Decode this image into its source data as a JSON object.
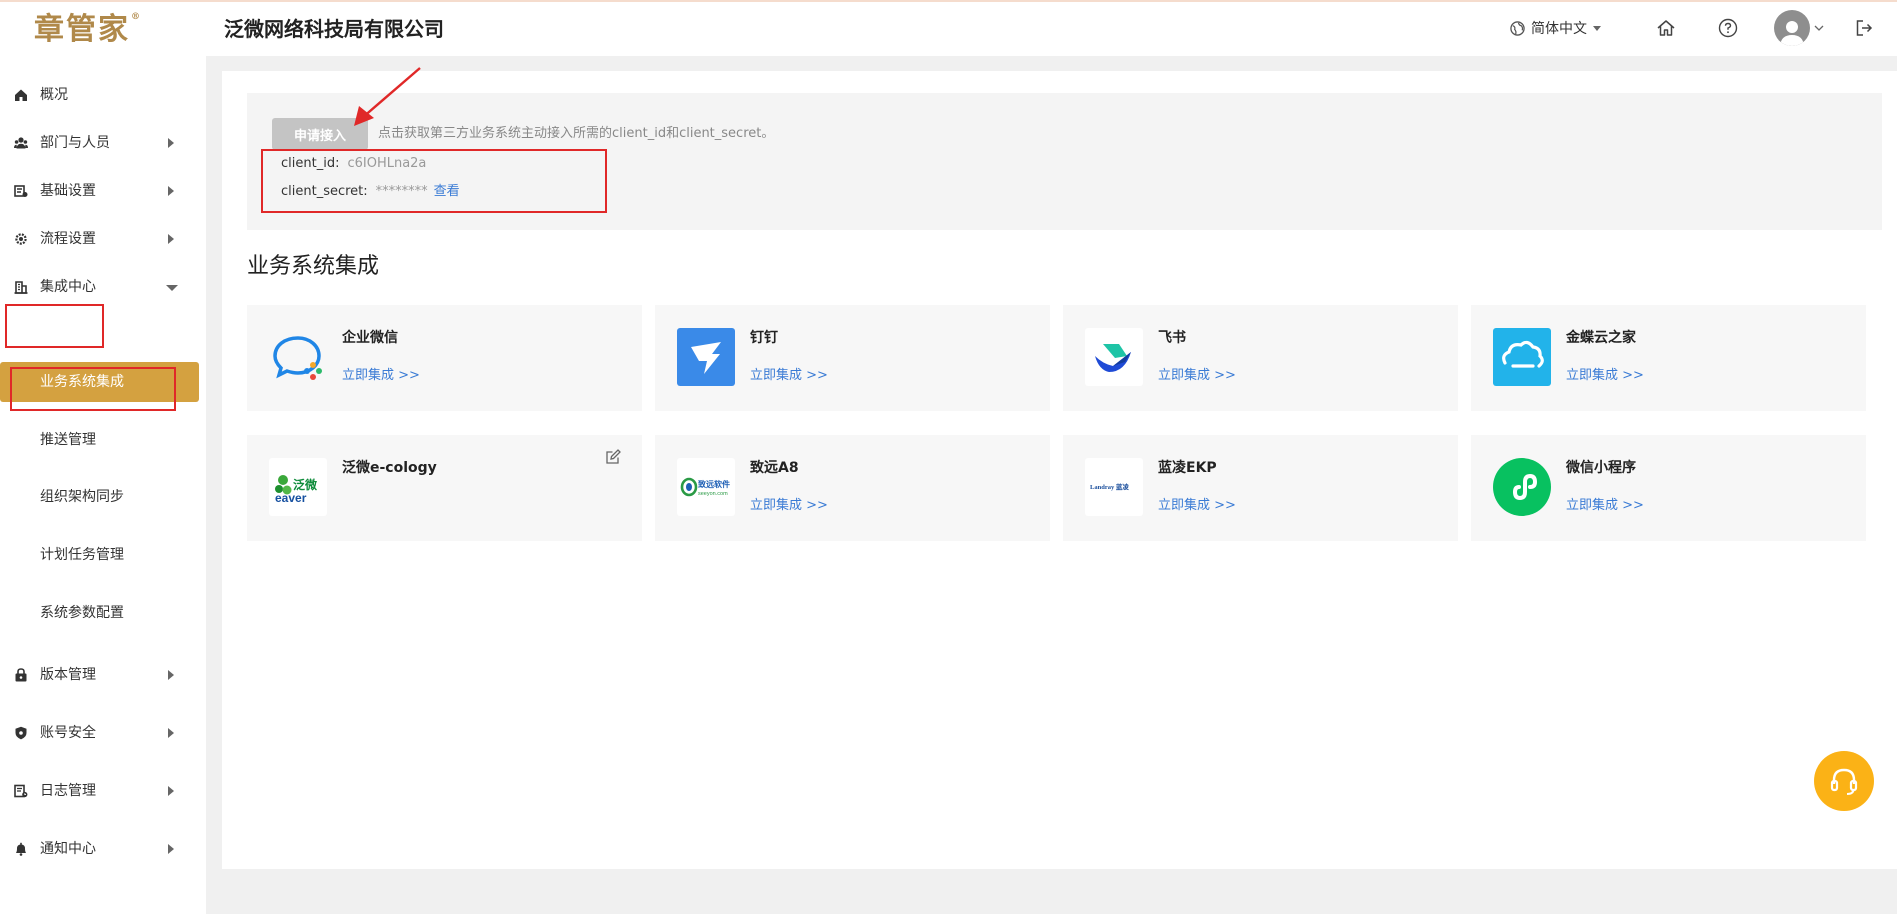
{
  "header": {
    "logo": "章管家",
    "logo_mark": "®",
    "company": "泛微网络科技局有限公司",
    "language": "简体中文"
  },
  "sidebar": {
    "items": [
      {
        "label": "概况",
        "icon": "home-icon"
      },
      {
        "label": "部门与人员",
        "icon": "users-icon"
      },
      {
        "label": "基础设置",
        "icon": "settings-list-icon"
      },
      {
        "label": "流程设置",
        "icon": "gear-icon"
      },
      {
        "label": "集成中心",
        "icon": "building-icon"
      },
      {
        "label": "版本管理",
        "icon": "lock-icon"
      },
      {
        "label": "账号安全",
        "icon": "shield-icon"
      },
      {
        "label": "日志管理",
        "icon": "log-icon"
      },
      {
        "label": "通知中心",
        "icon": "bell-icon"
      }
    ],
    "sub_items": [
      {
        "label": "业务系统集成"
      },
      {
        "label": "推送管理"
      },
      {
        "label": "组织架构同步"
      },
      {
        "label": "计划任务管理"
      },
      {
        "label": "系统参数配置"
      }
    ]
  },
  "access": {
    "button": "申请接入",
    "hint": "点击获取第三方业务系统主动接入所需的client_id和client_secret。",
    "client_id_label": "client_id:",
    "client_id_value": "c6IOHLna2a",
    "client_secret_label": "client_secret:",
    "client_secret_value": "********",
    "view_link": "查看"
  },
  "section_title": "业务系统集成",
  "cards": [
    {
      "title": "企业微信",
      "link": "立即集成 >>",
      "icon": "wecom-icon"
    },
    {
      "title": "钉钉",
      "link": "立即集成 >>",
      "icon": "dingtalk-icon"
    },
    {
      "title": "飞书",
      "link": "立即集成 >>",
      "icon": "feishu-icon"
    },
    {
      "title": "金蝶云之家",
      "link": "立即集成 >>",
      "icon": "kingdee-cloud-icon"
    },
    {
      "title": "泛微e-cology",
      "link": "",
      "icon": "weaver-icon",
      "logo_text": "泛微",
      "logo_sub": "eaver"
    },
    {
      "title": "致远A8",
      "link": "立即集成 >>",
      "icon": "seeyon-icon",
      "logo_text": "致远软件",
      "logo_sub": "seeyon.com"
    },
    {
      "title": "蓝凌EKP",
      "link": "立即集成 >>",
      "icon": "landray-icon",
      "logo_text": "Landray 蓝凌"
    },
    {
      "title": "微信小程序",
      "link": "立即集成 >>",
      "icon": "wechat-miniprogram-icon"
    }
  ],
  "colors": {
    "accent": "#d4a140",
    "link": "#3a7bd5",
    "highlight_border": "#e02828",
    "float_button": "#fbb216"
  }
}
